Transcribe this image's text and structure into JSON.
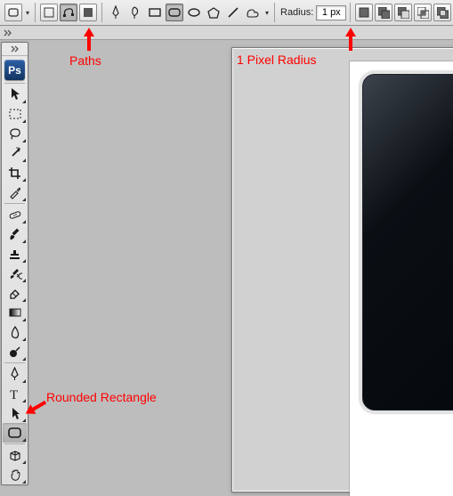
{
  "options_bar": {
    "radius_label": "Radius:",
    "radius_value": "1 px"
  },
  "app": {
    "logo_text": "Ps"
  },
  "annotations": {
    "paths": "Paths",
    "radius": "1 Pixel Radius",
    "rounded_rect": "Rounded Rectangle"
  }
}
